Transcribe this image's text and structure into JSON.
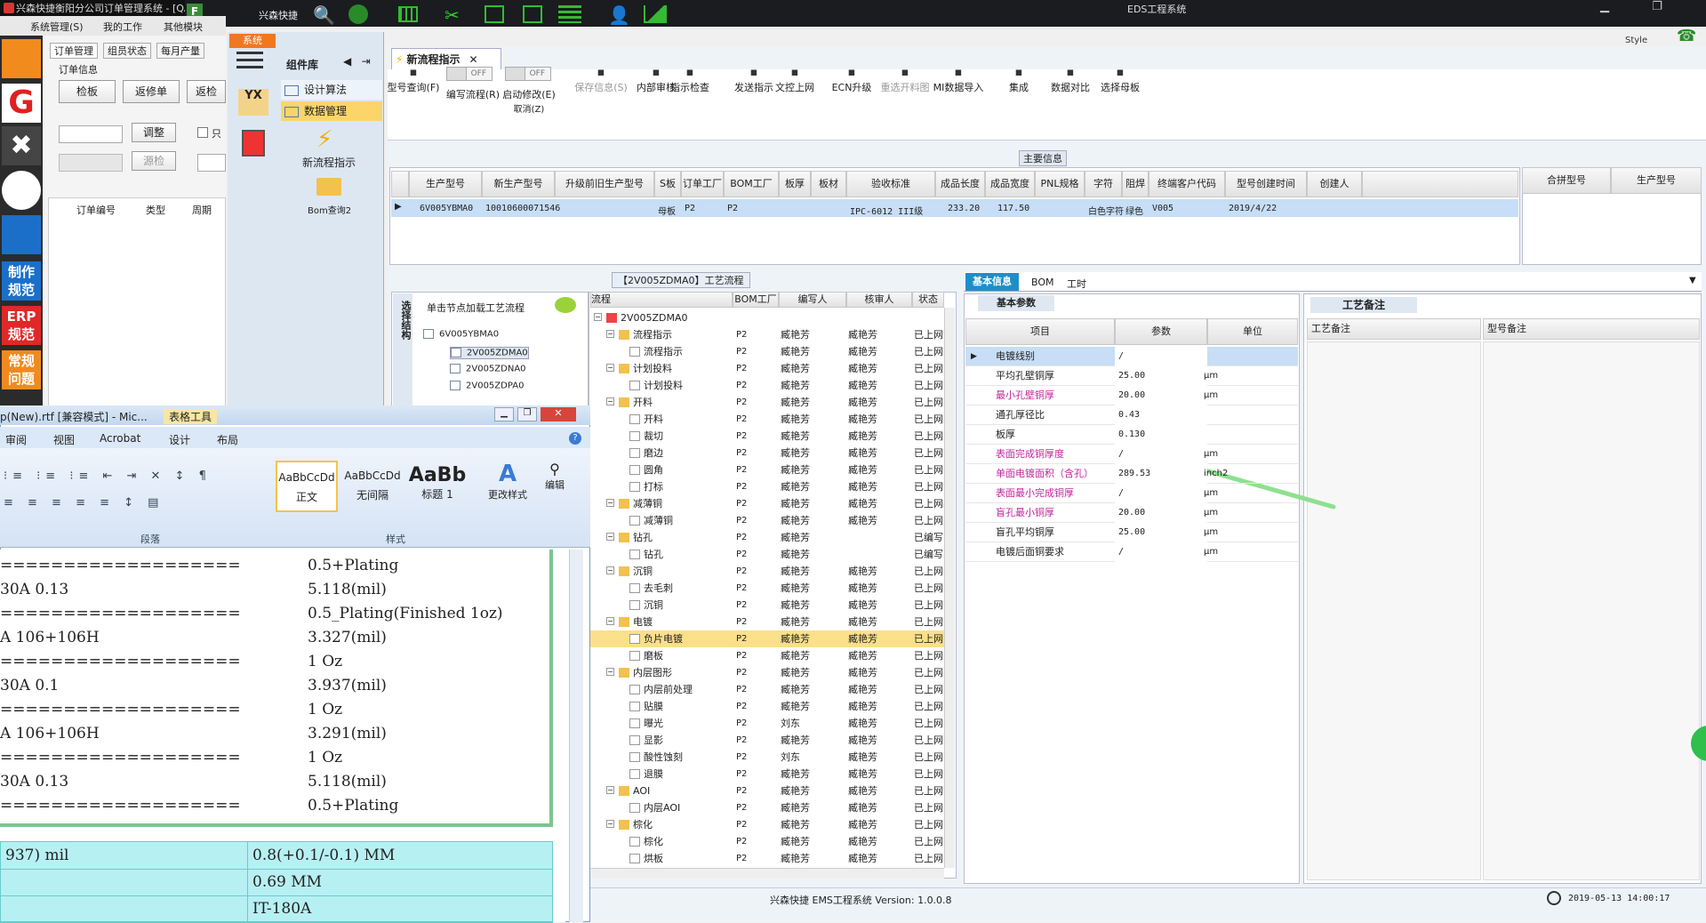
{
  "window_title": "兴森快捷衡阳分公司订单管理系统 - [QA组",
  "eds_title": "EDS工程系统",
  "style_label": "Style",
  "brand": "兴森快捷",
  "left_app": {
    "menu": [
      "系统管理(S)",
      "我的工作",
      "其他模块"
    ],
    "tabs": [
      "订单管理",
      "组员状态",
      "每月产量"
    ],
    "group": "订单信息",
    "buttons": [
      "检板",
      "返修单",
      "返检"
    ],
    "adjust_btn": "调整",
    "source_btn": "源检",
    "columns": [
      "订单编号",
      "类型",
      "周期"
    ],
    "only_label": "只",
    "side_labels": [
      "制作规范",
      "ERP规范",
      "常规问题"
    ]
  },
  "eds": {
    "system_tab": "系统",
    "component_lib": "组件库",
    "lib_items": [
      "设计算法",
      "数据管理"
    ],
    "new_flow_label": "新流程指示",
    "bom_query": "Bom查询2",
    "yx_label": "YX",
    "doc_tab": "新流程指示",
    "toolbar": [
      "型号查询(F)",
      "编写流程(R)",
      "启动修改(E)",
      "保存信息(S)",
      "内部审核",
      "指示检查",
      "发送指示",
      "文控上网",
      "ECN升级",
      "重选开料图",
      "MI数据导入",
      "集成",
      "数据对比",
      "选择母板"
    ],
    "toolbar_sub": "取消(Z)",
    "toggle_off": "OFF",
    "main_info": "主要信息",
    "grid_headers": [
      "生产型号",
      "新生产型号",
      "升级前旧生产型号",
      "S板",
      "订单工厂",
      "BOM工厂",
      "板厚",
      "板材",
      "验收标准",
      "成品长度",
      "成品宽度",
      "PNL规格",
      "字符",
      "阻焊",
      "终端客户代码",
      "型号创建时间",
      "创建人"
    ],
    "grid_row": [
      "6V005YBMA0",
      "10010600071546",
      "",
      "母板",
      "P2",
      "P2",
      "",
      "",
      "IPC-6012 III级",
      "233.20",
      "117.50",
      "",
      "白色字符",
      "绿色",
      "V005",
      "2019/4/22",
      ""
    ],
    "right_headers": [
      "合拼型号",
      "生产型号"
    ],
    "process_title": "【2V005ZDMA0】工艺流程",
    "tree_hint": "单击节点加载工艺流程",
    "tree_side": "选择结构",
    "tree_nodes": [
      "6V005YBMA0",
      "2V005ZDMA0",
      "2V005ZDNA0",
      "2V005ZDPA0"
    ],
    "flow_headers": [
      "流程",
      "BOM工厂",
      "编写人",
      "核审人",
      "状态"
    ],
    "flow_rows": [
      {
        "name": "2V005ZDMA0",
        "lvl": 0,
        "bom": "",
        "w": "",
        "r": "",
        "s": ""
      },
      {
        "name": "流程指示",
        "lvl": 1,
        "bom": "P2",
        "w": "臧艳芳",
        "r": "臧艳芳",
        "s": "已上网"
      },
      {
        "name": "流程指示",
        "lvl": 2,
        "bom": "P2",
        "w": "臧艳芳",
        "r": "臧艳芳",
        "s": "已上网"
      },
      {
        "name": "计划投料",
        "lvl": 1,
        "bom": "P2",
        "w": "臧艳芳",
        "r": "臧艳芳",
        "s": "已上网"
      },
      {
        "name": "计划投料",
        "lvl": 2,
        "bom": "P2",
        "w": "臧艳芳",
        "r": "臧艳芳",
        "s": "已上网"
      },
      {
        "name": "开料",
        "lvl": 1,
        "bom": "P2",
        "w": "臧艳芳",
        "r": "臧艳芳",
        "s": "已上网"
      },
      {
        "name": "开料",
        "lvl": 2,
        "bom": "P2",
        "w": "臧艳芳",
        "r": "臧艳芳",
        "s": "已上网"
      },
      {
        "name": "裁切",
        "lvl": 2,
        "bom": "P2",
        "w": "臧艳芳",
        "r": "臧艳芳",
        "s": "已上网"
      },
      {
        "name": "磨边",
        "lvl": 2,
        "bom": "P2",
        "w": "臧艳芳",
        "r": "臧艳芳",
        "s": "已上网"
      },
      {
        "name": "圆角",
        "lvl": 2,
        "bom": "P2",
        "w": "臧艳芳",
        "r": "臧艳芳",
        "s": "已上网"
      },
      {
        "name": "打标",
        "lvl": 2,
        "bom": "P2",
        "w": "臧艳芳",
        "r": "臧艳芳",
        "s": "已上网"
      },
      {
        "name": "减薄铜",
        "lvl": 1,
        "bom": "P2",
        "w": "臧艳芳",
        "r": "臧艳芳",
        "s": "已上网"
      },
      {
        "name": "减薄铜",
        "lvl": 2,
        "bom": "P2",
        "w": "臧艳芳",
        "r": "臧艳芳",
        "s": "已上网"
      },
      {
        "name": "钻孔",
        "lvl": 1,
        "bom": "P2",
        "w": "臧艳芳",
        "r": "",
        "s": "已编写"
      },
      {
        "name": "钻孔",
        "lvl": 2,
        "bom": "P2",
        "w": "臧艳芳",
        "r": "",
        "s": "已编写"
      },
      {
        "name": "沉铜",
        "lvl": 1,
        "bom": "P2",
        "w": "臧艳芳",
        "r": "臧艳芳",
        "s": "已上网"
      },
      {
        "name": "去毛刺",
        "lvl": 2,
        "bom": "P2",
        "w": "臧艳芳",
        "r": "臧艳芳",
        "s": "已上网"
      },
      {
        "name": "沉铜",
        "lvl": 2,
        "bom": "P2",
        "w": "臧艳芳",
        "r": "臧艳芳",
        "s": "已上网"
      },
      {
        "name": "电镀",
        "lvl": 1,
        "bom": "P2",
        "w": "臧艳芳",
        "r": "臧艳芳",
        "s": "已上网"
      },
      {
        "name": "负片电镀",
        "lvl": 2,
        "bom": "P2",
        "w": "臧艳芳",
        "r": "臧艳芳",
        "s": "已上网",
        "sel": true
      },
      {
        "name": "磨板",
        "lvl": 2,
        "bom": "P2",
        "w": "臧艳芳",
        "r": "臧艳芳",
        "s": "已上网"
      },
      {
        "name": "内层图形",
        "lvl": 1,
        "bom": "P2",
        "w": "臧艳芳",
        "r": "臧艳芳",
        "s": "已上网"
      },
      {
        "name": "内层前处理",
        "lvl": 2,
        "bom": "P2",
        "w": "臧艳芳",
        "r": "臧艳芳",
        "s": "已上网"
      },
      {
        "name": "贴膜",
        "lvl": 2,
        "bom": "P2",
        "w": "臧艳芳",
        "r": "臧艳芳",
        "s": "已上网"
      },
      {
        "name": "曝光",
        "lvl": 2,
        "bom": "P2",
        "w": "刘东",
        "r": "臧艳芳",
        "s": "已上网"
      },
      {
        "name": "显影",
        "lvl": 2,
        "bom": "P2",
        "w": "臧艳芳",
        "r": "臧艳芳",
        "s": "已上网"
      },
      {
        "name": "酸性蚀刻",
        "lvl": 2,
        "bom": "P2",
        "w": "刘东",
        "r": "臧艳芳",
        "s": "已上网"
      },
      {
        "name": "退膜",
        "lvl": 2,
        "bom": "P2",
        "w": "臧艳芳",
        "r": "臧艳芳",
        "s": "已上网"
      },
      {
        "name": "AOI",
        "lvl": 1,
        "bom": "P2",
        "w": "臧艳芳",
        "r": "臧艳芳",
        "s": "已上网"
      },
      {
        "name": "内层AOI",
        "lvl": 2,
        "bom": "P2",
        "w": "臧艳芳",
        "r": "臧艳芳",
        "s": "已上网"
      },
      {
        "name": "棕化",
        "lvl": 1,
        "bom": "P2",
        "w": "臧艳芳",
        "r": "臧艳芳",
        "s": "已上网"
      },
      {
        "name": "棕化",
        "lvl": 2,
        "bom": "P2",
        "w": "臧艳芳",
        "r": "臧艳芳",
        "s": "已上网"
      },
      {
        "name": "烘板",
        "lvl": 2,
        "bom": "P2",
        "w": "臧艳芳",
        "r": "臧艳芳",
        "s": "已上网"
      }
    ],
    "detail_tabs": [
      "基本信息",
      "BOM",
      "工时"
    ],
    "basic_params": "基本参数",
    "param_headers": [
      "项目",
      "参数",
      "单位"
    ],
    "params": [
      {
        "item": "电镀线别",
        "value": "/",
        "unit": "",
        "pink": false
      },
      {
        "item": "平均孔壁铜厚",
        "value": "25.00",
        "unit": "μm",
        "pink": false
      },
      {
        "item": "最小孔壁铜厚",
        "value": "20.00",
        "unit": "μm",
        "pink": true
      },
      {
        "item": "通孔厚径比",
        "value": "0.43",
        "unit": "",
        "pink": false
      },
      {
        "item": "板厚",
        "value": "0.130",
        "unit": "",
        "pink": false
      },
      {
        "item": "表面完成铜厚度",
        "value": "/",
        "unit": "μm",
        "pink": true
      },
      {
        "item": "单面电镀面积（含孔）",
        "value": "289.53",
        "unit": "inch2",
        "pink": true
      },
      {
        "item": "表面最小完成铜厚",
        "value": "/",
        "unit": "μm",
        "pink": true
      },
      {
        "item": "盲孔最小铜厚",
        "value": "20.00",
        "unit": "μm",
        "pink": true
      },
      {
        "item": "盲孔平均铜厚",
        "value": "25.00",
        "unit": "μm",
        "pink": false
      },
      {
        "item": "电镀后面铜要求",
        "value": "/",
        "unit": "μm",
        "pink": false
      }
    ],
    "craft_note_tab": "工艺备注",
    "craft_note_cols": [
      "工艺备注",
      "型号备注"
    ],
    "status": "兴森快捷 EMS工程系统 Version: 1.0.0.8",
    "datetime": "2019-05-13 14:00:17"
  },
  "word": {
    "title": "p(New).rtf [兼容模式] - Mic...",
    "table_tools": "表格工具",
    "ribbon_tabs": [
      "审阅",
      "视图",
      "Acrobat",
      "设计",
      "布局"
    ],
    "styles": [
      {
        "sample": "AaBbCcDd",
        "name": "正文"
      },
      {
        "sample": "AaBbCcDd",
        "name": "无间隔"
      },
      {
        "sample": "AaBb",
        "name": "标题 1"
      }
    ],
    "change_styles": "更改样式",
    "edit": "编辑",
    "groups": [
      "段落",
      "样式"
    ],
    "lines": [
      {
        "l": "=======================================",
        "r": "0.5+Plating"
      },
      {
        "l": "30A    0.13",
        "r": "5.118(mil)"
      },
      {
        "l": "=======================================",
        "r": "0.5_Plating(Finished 1oz)"
      },
      {
        "l": "A    106+106H",
        "r": "3.327(mil)"
      },
      {
        "l": "=======================================",
        "r": "1 Oz"
      },
      {
        "l": "30A    0.1",
        "r": "3.937(mil)"
      },
      {
        "l": "=======================================",
        "r": "1 Oz"
      },
      {
        "l": "A    106+106H",
        "r": "3.291(mil)"
      },
      {
        "l": "=======================================",
        "r": "1 Oz"
      },
      {
        "l": "30A    0.13",
        "r": "5.118(mil)"
      },
      {
        "l": "=======================================",
        "r": "0.5+Plating"
      }
    ],
    "table": [
      {
        "a": "937) mil",
        "b": "0.8(+0.1/-0.1) MM"
      },
      {
        "a": "",
        "b": "0.69 MM"
      },
      {
        "a": "",
        "b": "IT-180A"
      }
    ]
  },
  "colors": {
    "accent": "#1f8ec8",
    "selection": "#c7def6",
    "highlight": "#fbe08a",
    "pink": "#c0269a",
    "arrow": "#8ee08e"
  }
}
